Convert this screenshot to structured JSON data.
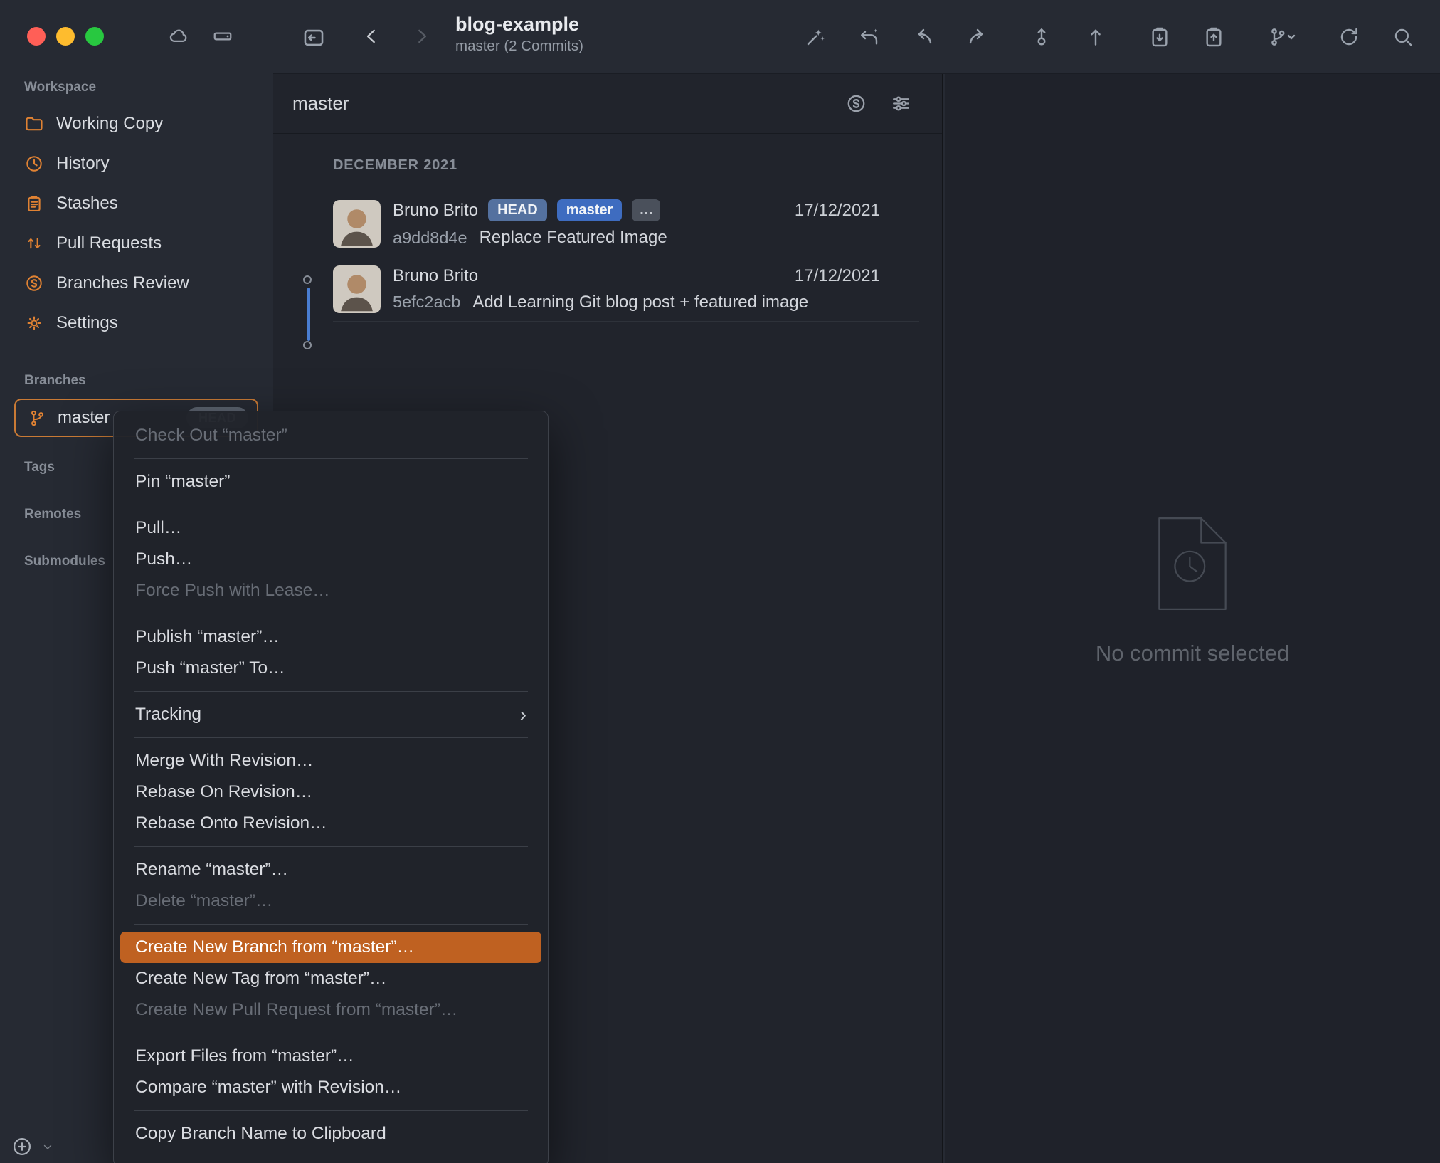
{
  "colors": {
    "accent_orange": "#e08233",
    "menu_highlight": "#bf6121",
    "badge_head_bg": "#54719f",
    "badge_master_bg": "#3e6cc0",
    "badge_more_bg": "#4a505b",
    "graph_line": "#4a7ed2",
    "sidebar_badge_bg": "#5c6470"
  },
  "titlebar": {
    "title": "blog-example",
    "subtitle": "master (2 Commits)"
  },
  "sidebar": {
    "workspace_header": "Workspace",
    "workspace_items": [
      {
        "label": "Working Copy",
        "icon": "folder-icon"
      },
      {
        "label": "History",
        "icon": "history-clock-icon"
      },
      {
        "label": "Stashes",
        "icon": "clipboard-icon"
      },
      {
        "label": "Pull Requests",
        "icon": "pull-request-icon"
      },
      {
        "label": "Branches Review",
        "icon": "branches-review-icon"
      },
      {
        "label": "Settings",
        "icon": "gear-icon"
      }
    ],
    "branches_header": "Branches",
    "branch_item": {
      "label": "master",
      "badge": "HEAD"
    },
    "tags_header": "Tags",
    "remotes_header": "Remotes",
    "submodules_header": "Submodules"
  },
  "commit_panel": {
    "filter_label": "master",
    "group_header": "DECEMBER 2021",
    "commits": [
      {
        "author": "Bruno Brito",
        "badges": [
          "HEAD",
          "master",
          "…"
        ],
        "date": "17/12/2021",
        "hash": "a9dd8d4e",
        "message": "Replace Featured Image"
      },
      {
        "author": "Bruno Brito",
        "date": "17/12/2021",
        "hash": "5efc2acb",
        "message": "Add Learning Git blog post + featured image"
      }
    ]
  },
  "detail_panel": {
    "empty_message": "No commit selected"
  },
  "context_menu": {
    "items": [
      {
        "label": "Check Out “master”",
        "state": "disabled"
      },
      {
        "label": "Pin “master”"
      },
      {
        "label": "Pull…"
      },
      {
        "label": "Push…"
      },
      {
        "label": "Force Push with Lease…",
        "state": "disabled"
      },
      {
        "label": "Publish “master”…"
      },
      {
        "label": "Push “master” To…"
      },
      {
        "label": "Tracking",
        "submenu": true
      },
      {
        "label": "Merge With Revision…"
      },
      {
        "label": "Rebase On Revision…"
      },
      {
        "label": "Rebase Onto Revision…"
      },
      {
        "label": "Rename “master”…"
      },
      {
        "label": "Delete “master”…",
        "state": "disabled"
      },
      {
        "label": "Create New Branch from “master”…",
        "state": "highlighted"
      },
      {
        "label": "Create New Tag from “master”…"
      },
      {
        "label": "Create New Pull Request from “master”…",
        "state": "disabled"
      },
      {
        "label": "Export Files from “master”…"
      },
      {
        "label": "Compare “master” with Revision…"
      },
      {
        "label": "Copy Branch Name to Clipboard"
      }
    ]
  }
}
